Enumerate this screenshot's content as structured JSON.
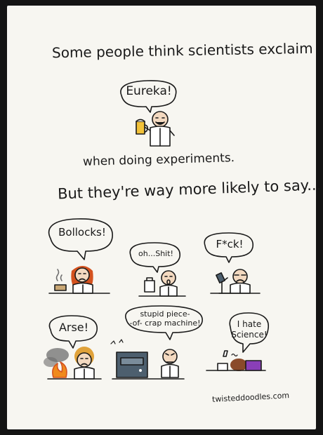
{
  "heading": {
    "line1": "Some people think scientists exclaim",
    "line2": "when doing experiments.",
    "line3": "But they're way more likely to say..."
  },
  "bubbles": {
    "eureka": "Eureka!",
    "bollocks": "Bollocks!",
    "oh_shit": "oh...Shit!",
    "fck": "F*ck!",
    "arse": "Arse!",
    "stupid_line1": "stupid piece-",
    "stupid_line2": "-of- crap machine!",
    "hate_line1": "I hate",
    "hate_line2": "Science!"
  },
  "signature": "twisteddoodles.com",
  "colors": {
    "paper": "#f7f6f1",
    "frame": "#141414",
    "ink": "#1a1a1a",
    "beer": "#f2c23a",
    "hair_red": "#d4521f",
    "hair_curly": "#e0a23a",
    "fire": "#f08a1c",
    "smoke": "#6d6d6d",
    "machine": "#4d5f6e",
    "purple": "#8a3fb8",
    "skin": "#f3d9c0"
  }
}
